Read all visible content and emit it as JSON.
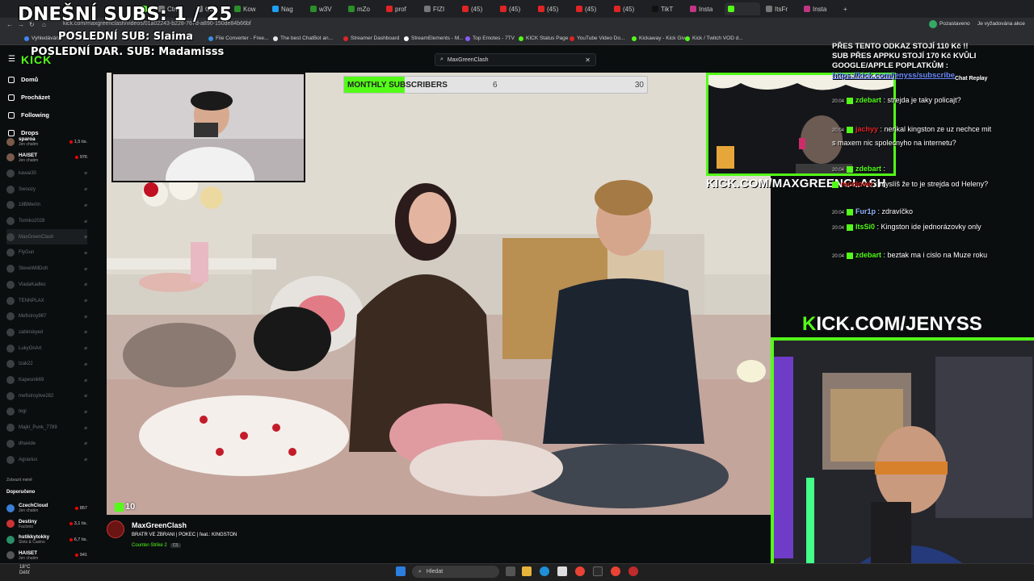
{
  "browser": {
    "tabs": [
      {
        "label": "",
        "color": "#53fc18"
      },
      {
        "label": "Ctrl",
        "color": "#777"
      },
      {
        "label": "Ctrl",
        "color": "#777"
      },
      {
        "label": "Kow",
        "color": "#2a8f2a"
      },
      {
        "label": "Nag",
        "color": "#1da1f2"
      },
      {
        "label": "w3V",
        "color": "#2a8f2a"
      },
      {
        "label": "mZo",
        "color": "#2a8f2a"
      },
      {
        "label": "prof",
        "color": "#e02424"
      },
      {
        "label": "FIZI",
        "color": "#777"
      },
      {
        "label": "(45)",
        "color": "#e02424"
      },
      {
        "label": "(45)",
        "color": "#e02424"
      },
      {
        "label": "(45)",
        "color": "#e02424"
      },
      {
        "label": "(45)",
        "color": "#e02424"
      },
      {
        "label": "(45)",
        "color": "#e02424"
      },
      {
        "label": "TikT",
        "color": "#111"
      },
      {
        "label": "Insta",
        "color": "#c13584"
      },
      {
        "label": "",
        "color": "#53fc18"
      },
      {
        "label": "ItsFr",
        "color": "#777"
      },
      {
        "label": "Insta",
        "color": "#c13584"
      }
    ],
    "url": "kick.com/maxgreenclash/videos/01a02243-b228-767d-a890-150de84b66bf",
    "profile_status": "Pozastaveno",
    "profile_note": "Je vyžadována akce",
    "bookmarks": [
      "Vyhledávání",
      "File Converter - Free...",
      "The best ChatBot an...",
      "Streamer Dashboard",
      "StreamElements - M...",
      "Top Emotes - 7TV",
      "KICK Status Page",
      "YouTube Video Do...",
      "Kickaway - Kick Giv...",
      "Kick / Twitch VOD d..."
    ]
  },
  "kick": {
    "logo": "KICK",
    "search_value": "MaxGreenClash"
  },
  "sidebar": {
    "nav": [
      {
        "label": "Domů",
        "icon": "home-icon"
      },
      {
        "label": "Procházet",
        "icon": "compass-icon"
      },
      {
        "label": "Following",
        "icon": "heart-icon"
      },
      {
        "label": "Drops",
        "icon": "gift-icon"
      }
    ],
    "recommended": [
      {
        "name": "sparoa",
        "sub": "Jen chatim",
        "viewers": "1,5 tis.",
        "live": true
      },
      {
        "name": "HAISET",
        "sub": "Jen chatim",
        "viewers": "976",
        "live": true
      },
      {
        "name": "kawai30",
        "sub": "",
        "viewers": "",
        "live": false
      },
      {
        "name": "Swoozy",
        "sub": "",
        "viewers": "",
        "live": false
      },
      {
        "name": "18BMerlin",
        "sub": "",
        "viewers": "",
        "live": false
      },
      {
        "name": "Tomiko2028",
        "sub": "",
        "viewers": "",
        "live": false
      },
      {
        "name": "MaxGreenClash",
        "sub": "",
        "viewers": "",
        "live": false
      },
      {
        "name": "FlyGun",
        "sub": "",
        "viewers": "",
        "live": false
      },
      {
        "name": "SteveWillDoIt",
        "sub": "",
        "viewers": "",
        "live": false
      },
      {
        "name": "VladaKadlec",
        "sub": "",
        "viewers": "",
        "live": false
      },
      {
        "name": "TENNPLAX",
        "sub": "",
        "viewers": "",
        "live": false
      },
      {
        "name": "Mefistroy987",
        "sub": "",
        "viewers": "",
        "live": false
      },
      {
        "name": "zabinskyed",
        "sub": "",
        "viewers": "",
        "live": false
      },
      {
        "name": "LukyOnArt",
        "sub": "",
        "viewers": "",
        "live": false
      },
      {
        "name": "Izak22",
        "sub": "",
        "viewers": "",
        "live": false
      },
      {
        "name": "Kapesnik69",
        "sub": "",
        "viewers": "",
        "live": false
      },
      {
        "name": "mefistroylive282",
        "sub": "",
        "viewers": "",
        "live": false
      },
      {
        "name": "tegi",
        "sub": "",
        "viewers": "",
        "live": false
      },
      {
        "name": "Majkl_Punk_7789",
        "sub": "",
        "viewers": "",
        "live": false
      },
      {
        "name": "dhavide",
        "sub": "",
        "viewers": "",
        "live": false
      },
      {
        "name": "Agravius",
        "sub": "",
        "viewers": "",
        "live": false
      }
    ],
    "show_less": "Zobrazit méně",
    "section_title": "Doporučeno",
    "featured": [
      {
        "name": "CzechCloud",
        "sub": "Jen chatim",
        "viewers": "857"
      },
      {
        "name": "Destiny",
        "sub": "Factorio",
        "viewers": "3,1 tis."
      },
      {
        "name": "hstikkytokky",
        "sub": "Slots & Casino",
        "viewers": "6,7 tis."
      },
      {
        "name": "HAISET",
        "sub": "Jen chatim",
        "viewers": "941"
      }
    ]
  },
  "overlay": {
    "subs": "DNEŠNÍ SUBS: 1 / 25",
    "last_sub": "POSLEDNÍ SUB: Slaima",
    "last_donation": "POSLEDNÍ DAR. SUB: Madamisss",
    "monthly_label": "MONTHLY SUBSCRIBERS",
    "monthly_current": "6",
    "monthly_goal": "30",
    "monthly_progress": 0.2,
    "viewer_count": "10",
    "maxgreen_url": "KICK.COM/MAXGREENCLASH",
    "jenyss_prefix": "K",
    "jenyss_rest": "ICK.COM/JENYSS"
  },
  "stream": {
    "streamer": "MaxGreenClash",
    "title": "BRATR VE ZBRANI | POKEC | feat.: KINGSTON",
    "category": "Counter-Strike 2",
    "category_tag": "CS"
  },
  "chat": {
    "header_line1": "PŘES TENTO ODKAZ STOJÍ 110 Kč !!",
    "header_line2": "SUB PŘES APPKU STOJÍ 170 Kč KVŮLI",
    "header_line3": "GOOGLE/APPLE POPLATKŮM :",
    "header_url": "https://kick.com/jenyss/subscribe",
    "replay_label": "Chat Replay",
    "messages": [
      {
        "ts": "20:04",
        "user": "zdebart",
        "color": "u-green",
        "text": ": strejda je taky policajt?"
      },
      {
        "ts": "20:04",
        "user": "jachyy",
        "color": "u-red",
        "text": ": nerikal kingston ze uz nechce mit s maxem nic spolecnyho na internetu?"
      },
      {
        "ts": "20:04",
        "user": "zdebart",
        "color": "u-green",
        "text": ":"
      },
      {
        "ts": "",
        "user": "mcolover",
        "color": "u-red",
        "text": ": myslíš že to je strejda od Heleny?"
      },
      {
        "ts": "20:04",
        "user": "Fur1p",
        "color": "u-blue",
        "text": ": zdravíčko"
      },
      {
        "ts": "20:04",
        "user": "ItsSi0",
        "color": "u-green",
        "text": ": Kingston ide jednorázovky only"
      },
      {
        "ts": "20:04",
        "user": "zdebart",
        "color": "u-green",
        "text": ": beztak ma i cislo na Muze roku"
      }
    ]
  },
  "taskbar": {
    "temperature": "18°C",
    "weather": "Déšť",
    "search_placeholder": "Hledat"
  }
}
